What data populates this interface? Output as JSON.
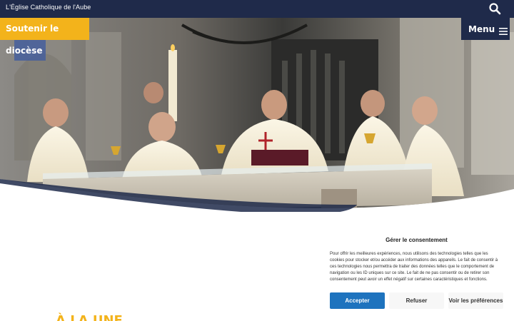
{
  "header": {
    "site_name": "L'Église Catholique de l'Aube",
    "search_icon": "search-icon"
  },
  "hero": {
    "image": "Célébration eucharistique dans une cathédrale"
  },
  "support_button": {
    "label": "Soutenir le diocèse"
  },
  "menu_button": {
    "label": "Menu",
    "icon": "hamburger-icon"
  },
  "consent": {
    "title": "Gérer le consentement",
    "body": "Pour offrir les meilleures expériences, nous utilisons des technologies telles que les cookies pour stocker et/ou accéder aux informations des appareils. Le fait de consentir à ces technologies nous permettra de traiter des données telles que le comportement de navigation ou les ID uniques sur ce site. Le fait de ne pas consentir ou de retirer son consentement peut avoir un effet négatif sur certaines caractéristiques et fonctions.",
    "accept_label": "Accepter",
    "refuse_label": "Refuser",
    "preferences_label": "Voir les préférences"
  },
  "section_heading_peek": "À LA UNE",
  "colors": {
    "navy": "#1f2a4a",
    "gold": "#f3b31b",
    "accept_blue": "#1e73be"
  }
}
